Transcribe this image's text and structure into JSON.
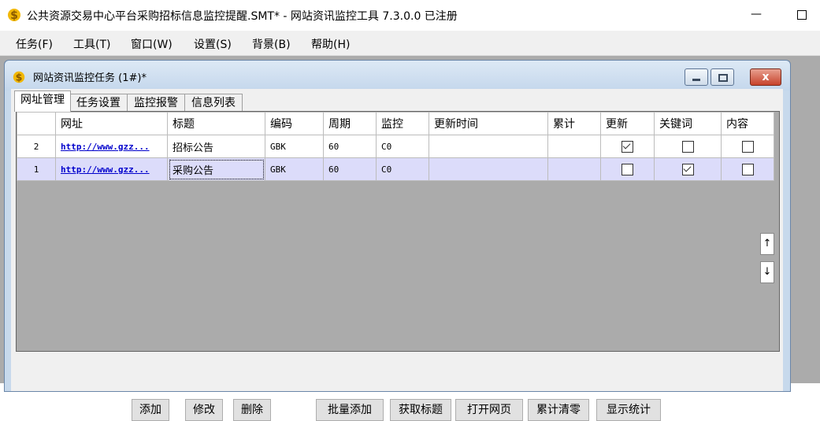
{
  "window": {
    "title": "公共资源交易中心平台采购招标信息监控提醒.SMT* - 网站资讯监控工具 7.3.0.0  已注册",
    "minimize_label": "—"
  },
  "menu": [
    {
      "label": "任务(F)"
    },
    {
      "label": "工具(T)"
    },
    {
      "label": "窗口(W)"
    },
    {
      "label": "设置(S)"
    },
    {
      "label": "背景(B)"
    },
    {
      "label": "帮助(H)"
    }
  ],
  "child_window": {
    "title": "网站资讯监控任务  (1#)*",
    "close_label": "x"
  },
  "tabs": [
    {
      "label": "网址管理",
      "active": true
    },
    {
      "label": "任务设置",
      "active": false
    },
    {
      "label": "监控报警",
      "active": false
    },
    {
      "label": "信息列表",
      "active": false
    }
  ],
  "grid": {
    "columns": [
      "",
      "网址",
      "标题",
      "编码",
      "周期",
      "监控",
      "更新时间",
      "累计",
      "更新",
      "关键词",
      "内容"
    ],
    "rows": [
      {
        "index": "2",
        "url": "http://www.gzz...",
        "title": "招标公告",
        "encoding": "GBK",
        "period": "60",
        "monitor": "C0",
        "update_time": "",
        "total": "",
        "update": true,
        "keyword": false,
        "content": false
      },
      {
        "index": "1",
        "url": "http://www.gzz...",
        "title": "采购公告",
        "encoding": "GBK",
        "period": "60",
        "monitor": "C0",
        "update_time": "",
        "total": "",
        "update": false,
        "keyword": true,
        "content": false
      }
    ],
    "move_up": "↑",
    "move_down": "↓"
  },
  "buttons": {
    "add": "添加",
    "edit": "修改",
    "delete": "删除",
    "batch_add": "批量添加",
    "fetch_title": "获取标题",
    "open_page": "打开网页",
    "clear_total": "累计清零",
    "show_stats": "显示统计"
  },
  "colors": {
    "selected_row": "#dcdcfa",
    "link": "#0000cc",
    "mdi_background": "#ababab"
  }
}
